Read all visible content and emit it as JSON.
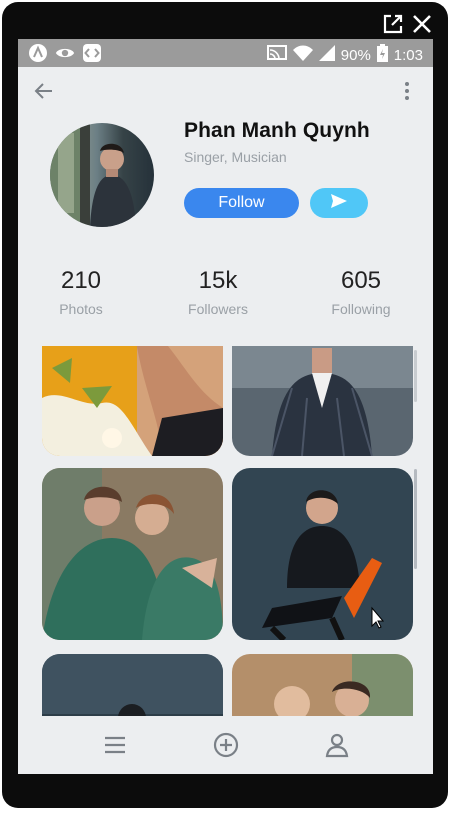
{
  "status_bar": {
    "battery": "90%",
    "time": "1:03",
    "icons": [
      "app-a-icon",
      "eye-icon",
      "code-icon",
      "cast-icon",
      "wifi-icon",
      "signal-icon",
      "battery-icon"
    ]
  },
  "window_controls": [
    "open-external-icon",
    "close-icon"
  ],
  "app_bar": {
    "back_icon": "arrow-left-icon",
    "menu_icon": "more-vertical-icon"
  },
  "profile": {
    "name": "Phan Manh Quynh",
    "subtitle": "Singer, Musician",
    "follow_label": "Follow",
    "send_icon": "send-icon"
  },
  "stats": [
    {
      "value": "210",
      "label": "Photos"
    },
    {
      "value": "15k",
      "label": "Followers"
    },
    {
      "value": "605",
      "label": "Following"
    }
  ],
  "bottom_nav": [
    "menu-icon",
    "add-circle-icon",
    "profile-icon"
  ],
  "colors": {
    "primary": "#3a87ee",
    "accent": "#50c7f7",
    "background": "#eceef0"
  }
}
